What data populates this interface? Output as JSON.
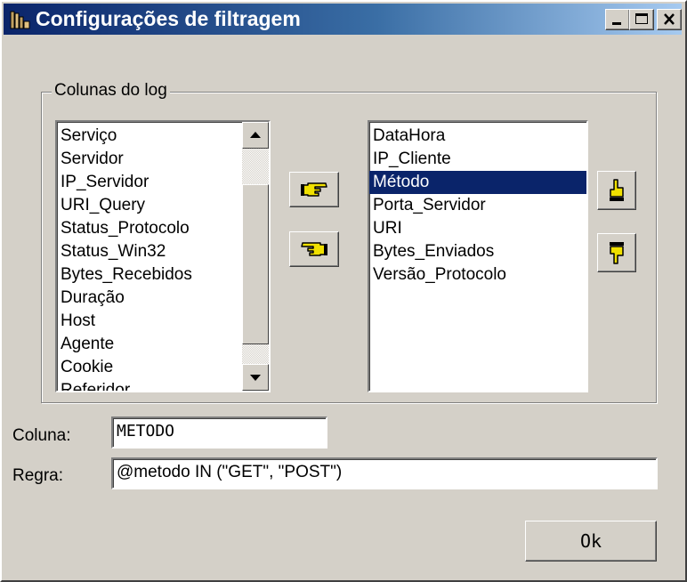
{
  "window": {
    "title": "Configurações de filtragem",
    "title_gradient": [
      "#0a246a",
      "#a6caf0"
    ],
    "controls": [
      "minimize-icon",
      "maximize-icon",
      "close-icon"
    ]
  },
  "group": {
    "label": "Colunas do log"
  },
  "available_columns": {
    "items": [
      "Serviço",
      "Servidor",
      "IP_Servidor",
      "URI_Query",
      "Status_Protocolo",
      "Status_Win32",
      "Bytes_Recebidos",
      "Duração",
      "Host",
      "Agente",
      "Cookie",
      "Referidor"
    ]
  },
  "selected_columns": {
    "items": [
      "DataHora",
      "IP_Cliente",
      "Método",
      "Porta_Servidor",
      "URI",
      "Bytes_Enviados",
      "Versão_Protocolo"
    ],
    "selected_index": 2,
    "selection_color": "#0a246a"
  },
  "buttons": {
    "add_icon": "hand-pointing-right-icon",
    "remove_icon": "hand-pointing-left-icon",
    "move_up_icon": "hand-pointing-up-icon",
    "move_down_icon": "hand-pointing-down-icon",
    "ok_label": "Ok"
  },
  "fields": {
    "column_label": "Coluna:",
    "column_value": "METODO",
    "rule_label": "Regra:",
    "rule_value": "@metodo IN (\"GET\", \"POST\")"
  }
}
